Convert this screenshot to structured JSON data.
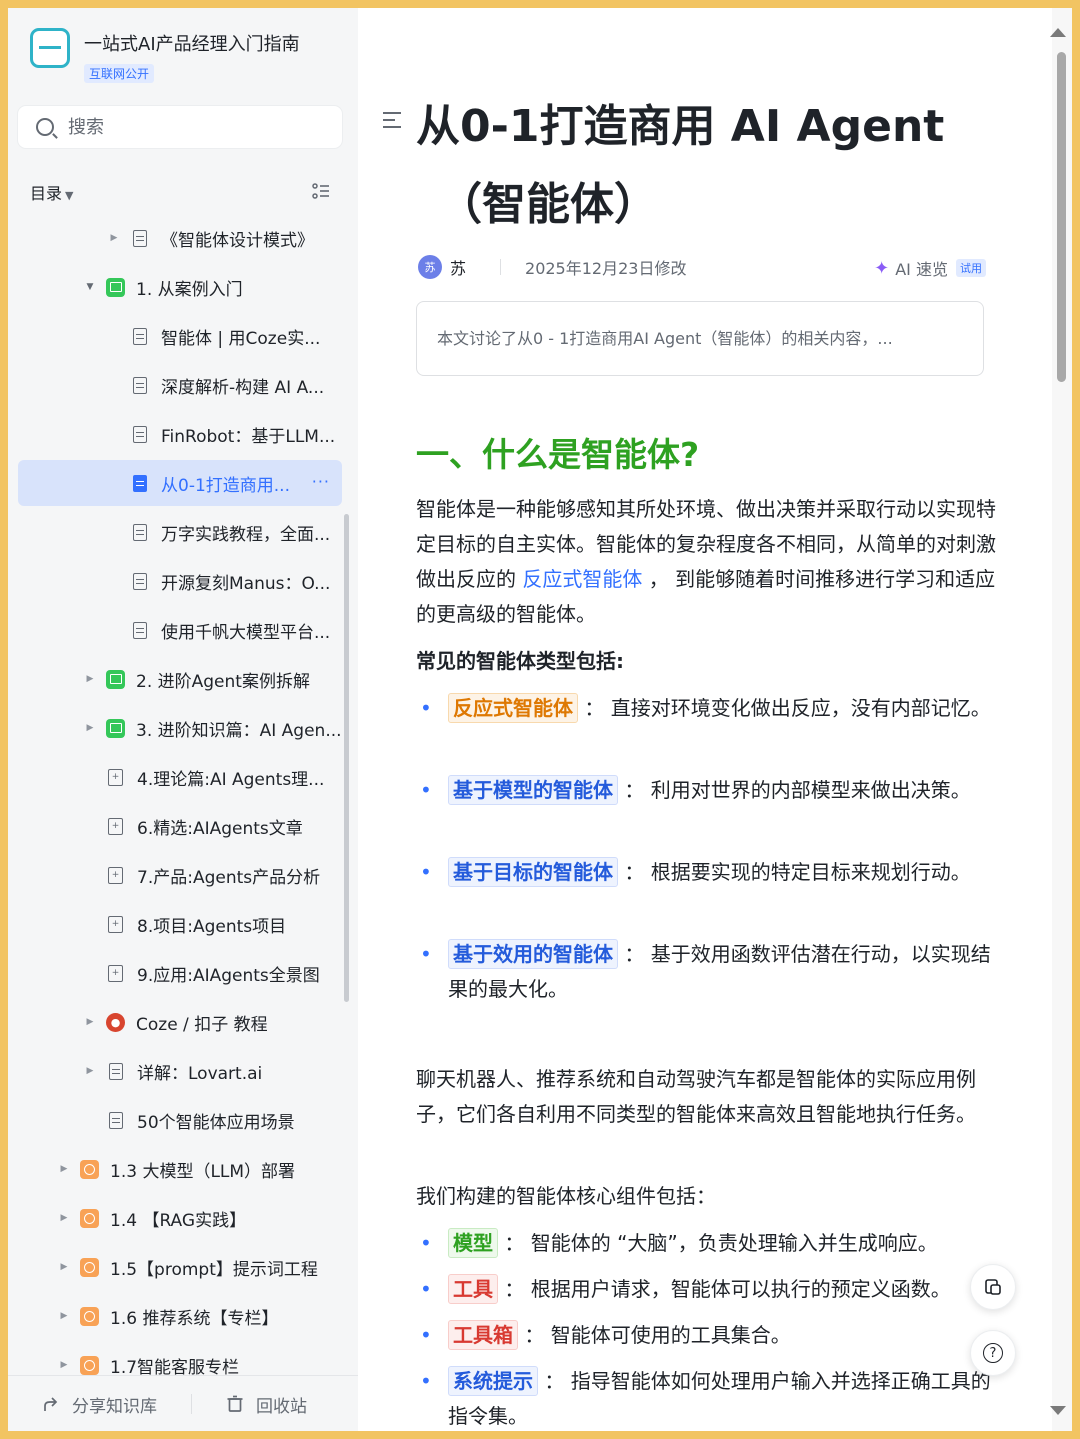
{
  "sidebar": {
    "kb_title": "一站式AI产品经理入门指南",
    "kb_badge": "互联网公开",
    "search_placeholder": "搜索",
    "toc_label": "目录",
    "tree": [
      {
        "label": "《智能体设计模式》"
      },
      {
        "label": "1. 从案例入门"
      },
      {
        "label": "智能体 | 用Coze实..."
      },
      {
        "label": "深度解析-构建 AI A..."
      },
      {
        "label": "FinRobot：基于LLM..."
      },
      {
        "label": "从0-1打造商用..."
      },
      {
        "label": "万字实践教程，全面..."
      },
      {
        "label": "开源复刻Manus：O..."
      },
      {
        "label": "使用千帆大模型平台..."
      },
      {
        "label": "2. 进阶Agent案例拆解"
      },
      {
        "label": "3. 进阶知识篇：AI Agen..."
      },
      {
        "label": "4.理论篇:AI Agents理..."
      },
      {
        "label": "6.精选:AIAgents文章"
      },
      {
        "label": "7.产品:Agents产品分析"
      },
      {
        "label": "8.项目:Agents项目"
      },
      {
        "label": "9.应用:AIAgents全景图"
      },
      {
        "label": "Coze / 扣子 教程"
      },
      {
        "label": "详解：Lovart.ai"
      },
      {
        "label": "50个智能体应用场景"
      },
      {
        "label": "1.3 大模型（LLM）部署"
      },
      {
        "label": "1.4 【RAG实践】"
      },
      {
        "label": "1.5【prompt】提示词工程"
      },
      {
        "label": "1.6 推荐系统【专栏】"
      },
      {
        "label": "1.7智能客服专栏"
      }
    ],
    "more_dots": "···",
    "share_label": "分享知识库",
    "recycle_label": "回收站"
  },
  "doc": {
    "title_line1": "从0-1打造商用 AI Agent",
    "title_line2": "（智能体）",
    "avatar_text": "苏",
    "author": "苏",
    "modified": "2025年12月23日修改",
    "ai_quick": "AI 速览",
    "trial": "试用",
    "summary": "本文讨论了从0 - 1打造商用AI Agent（智能体）的相关内容，...",
    "h1": "一、什么是智能体?",
    "p1_a": "智能体是一种能够感知其所处环境、做出决策并采取行动以实现特定目标的自主实体。智能体的复杂程度各不相同，从简单的对刺激做出反应的 ",
    "p1_link": "反应式智能体",
    "p1_b": " ， 到能够随着时间推移进行学习和适应的更高级的智能体。",
    "types_heading": "常见的智能体类型包括:",
    "types": [
      {
        "tag": "反应式智能体",
        "text": " ： 直接对环境变化做出反应，没有内部记忆。"
      },
      {
        "tag": "基于模型的智能体",
        "text": " ： 利用对世界的内部模型来做出决策。"
      },
      {
        "tag": "基于目标的智能体",
        "text": " ： 根据要实现的特定目标来规划行动。"
      },
      {
        "tag": "基于效用的智能体",
        "text": " ： 基于效用函数评估潜在行动，以实现结果的最大化。"
      }
    ],
    "p2": "聊天机器人、推荐系统和自动驾驶汽车都是智能体的实际应用例子，它们各自利用不同类型的智能体来高效且智能地执行任务。",
    "components_heading": "我们构建的智能体核心组件包括：",
    "components": [
      {
        "tag": "模型",
        "text": " ： 智能体的 “大脑”，负责处理输入并生成响应。"
      },
      {
        "tag": "工具",
        "text": " ： 根据用户请求，智能体可以执行的预定义函数。"
      },
      {
        "tag": "工具箱",
        "text": " ： 智能体可使用的工具集合。"
      },
      {
        "tag": "系统提示",
        "text": " ： 指导智能体如何处理用户输入并选择正确工具的指令集。"
      }
    ],
    "help_symbol": "?"
  }
}
